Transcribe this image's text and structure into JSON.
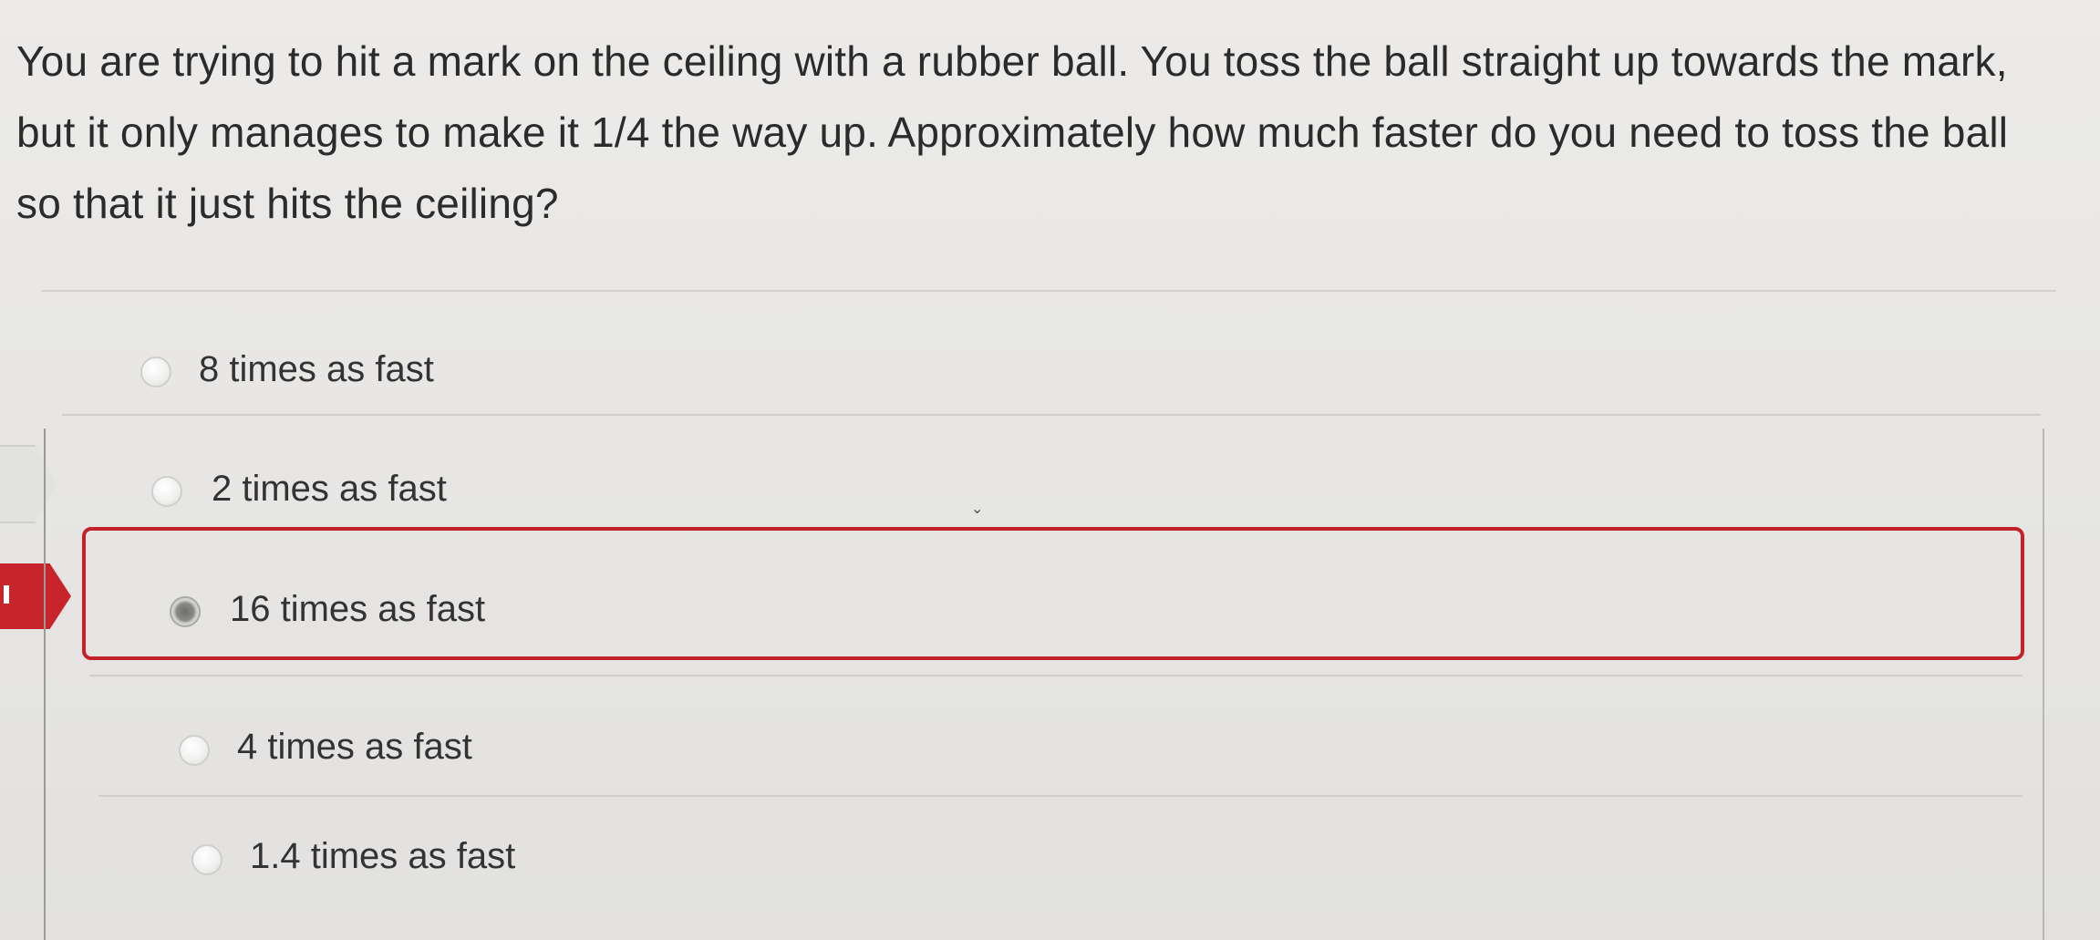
{
  "question": {
    "text": "You are trying to hit a mark on the ceiling with a rubber ball. You toss the ball straight up towards the mark, but it only manages to make it 1/4 the way up. Approximately how much faster do you need to toss the ball so that it just hits the ceiling?"
  },
  "answers": [
    {
      "label": "8 times as fast",
      "selected": false
    },
    {
      "label": "2 times as fast",
      "selected": false
    },
    {
      "label": "16 times as fast",
      "selected": true
    },
    {
      "label": "4 times as fast",
      "selected": false
    },
    {
      "label": "1.4 times as fast",
      "selected": false
    }
  ],
  "colors": {
    "selected_border": "#c3222a",
    "nav_active": "#c8242b",
    "text": "#333333"
  }
}
